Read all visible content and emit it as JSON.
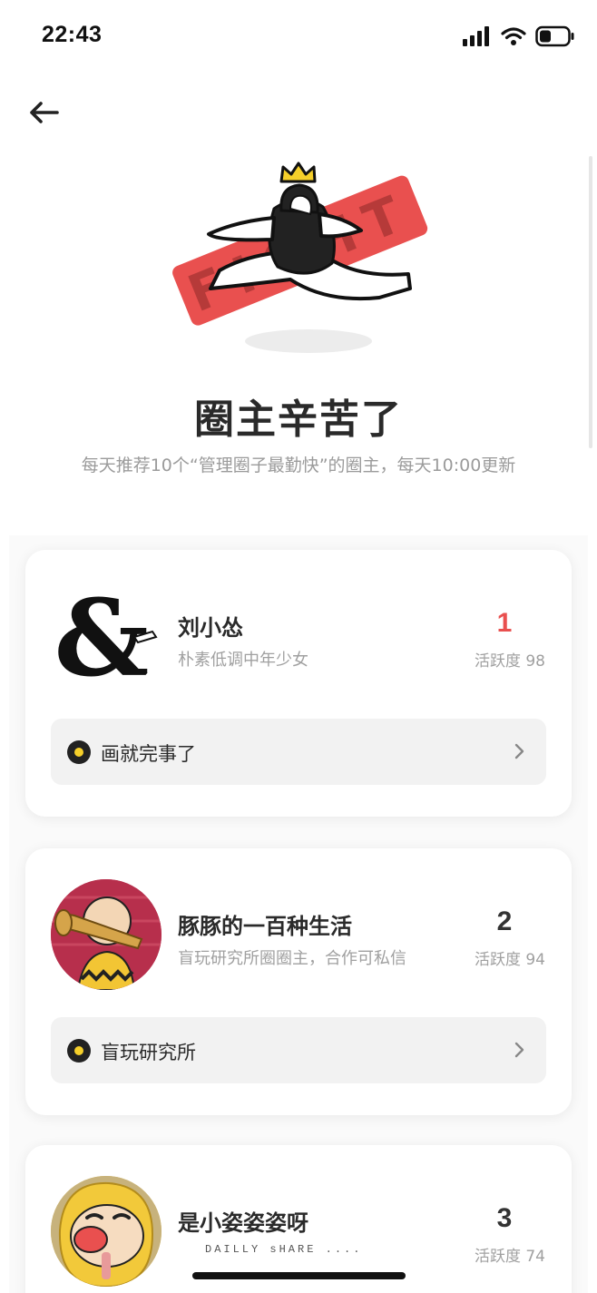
{
  "status_bar": {
    "time": "22:43"
  },
  "header": {
    "title": "圈主辛苦了",
    "subtitle": "每天推荐10个“管理圈子最勤快”的圈主，每天10:00更新"
  },
  "hero": {
    "badge_text": "FIGHT"
  },
  "cards": [
    {
      "rank": "1",
      "name": "刘小怂",
      "bio": "朴素低调中年少女",
      "activity": "活跃度 98",
      "circle": "画就完事了"
    },
    {
      "rank": "2",
      "name": "豚豚的一百种生活",
      "bio": "盲玩研究所圈圈主，合作可私信",
      "activity": "活跃度 94",
      "circle": "盲玩研究所"
    },
    {
      "rank": "3",
      "name": "是小姿姿姿呀",
      "bio": "",
      "activity": "活跃度 74",
      "circle": ""
    }
  ],
  "watermark": "DAILLY sHARE ....",
  "colors": {
    "rank_first": "#e9504f",
    "hero_badge": "#e9504f",
    "circle_dot": "#f5cf2a"
  },
  "icons": [
    "back-arrow-icon",
    "signal-icon",
    "wifi-icon",
    "battery-icon",
    "circle-badge-icon",
    "chevron-right-icon"
  ]
}
